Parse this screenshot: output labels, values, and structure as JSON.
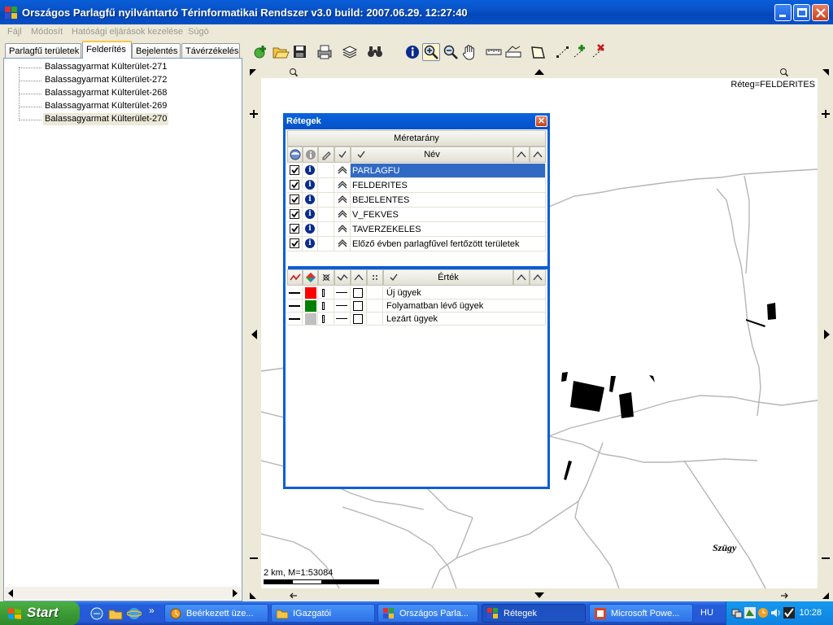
{
  "app": {
    "title": "Országos Parlagfű nyilvántartó Térinformatikai Rendszer v3.0 build: 2007.06.29. 12:27:40"
  },
  "menu": [
    "Fájl",
    "Módosít",
    "Hatósági eljárások kezelése",
    "Súgó"
  ],
  "tabs": [
    "Parlagfű területek",
    "Felderítés",
    "Bejelentés",
    "Távérzékelés"
  ],
  "tree": {
    "items": [
      "Balassagyarmat Külterület-271",
      "Balassagyarmat Külterület-272",
      "Balassagyarmat Külterület-268",
      "Balassagyarmat Külterület-269",
      "Balassagyarmat Külterület-270"
    ],
    "selected_index": 4
  },
  "map": {
    "layer_label": "Réteg=FELDERITES",
    "place_label": "Szügy",
    "scale_text": "2 km, M=1:53084"
  },
  "dialog": {
    "title": "Rétegek",
    "close_glyph": "✕",
    "scale_header": "Méretarány",
    "name_header": "Név",
    "value_header": "Érték",
    "layers": [
      {
        "name": "PARLAGFU",
        "checked": true,
        "selected": true
      },
      {
        "name": "FELDERITES",
        "checked": true,
        "selected": false
      },
      {
        "name": "BEJELENTES",
        "checked": true,
        "selected": false
      },
      {
        "name": "V_FEKVES",
        "checked": true,
        "selected": false
      },
      {
        "name": "TAVERZEKELES",
        "checked": true,
        "selected": false
      },
      {
        "name": "Előző évben parlagfűvel fertőzött területek",
        "checked": true,
        "selected": false
      }
    ],
    "legend": [
      {
        "label": "Új ügyek",
        "color": "#ff0000"
      },
      {
        "label": "Folyamatban lévő ügyek",
        "color": "#008000"
      },
      {
        "label": "Lezárt ügyek",
        "color": "#c0c0c0"
      }
    ]
  },
  "taskbar": {
    "start_label": "Start",
    "chevron": "»",
    "tasks": [
      {
        "label": "Beérkezett üze...",
        "active": false
      },
      {
        "label": "IGazgatói",
        "active": false
      },
      {
        "label": "Országos Parla...",
        "active": false
      },
      {
        "label": "Rétegek",
        "active": true
      },
      {
        "label": "Microsoft Powe...",
        "active": false
      }
    ],
    "language": "HU",
    "clock": "10:28"
  },
  "colors": {
    "title_blue": "#0a5fd8",
    "selection_blue": "#316ac5",
    "map_road": "#b8b8b8"
  }
}
